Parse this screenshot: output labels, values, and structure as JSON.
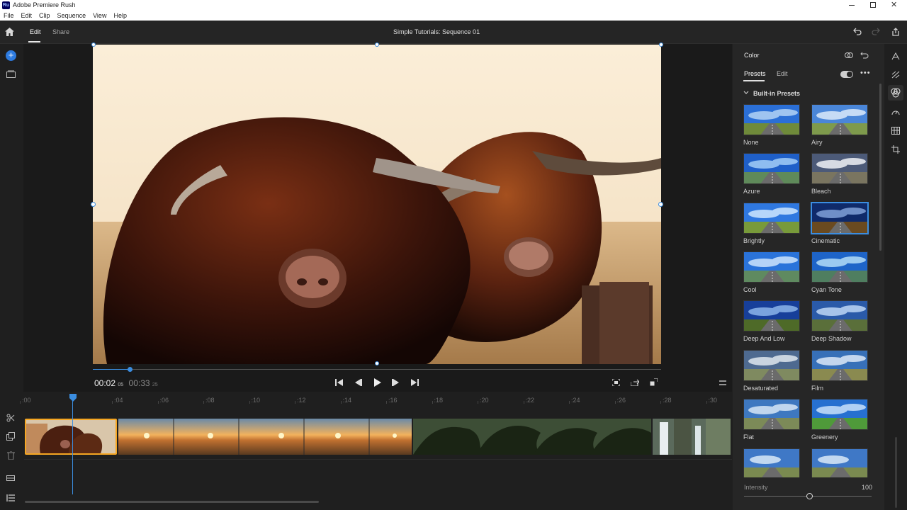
{
  "app": {
    "title": "Adobe Premiere Rush",
    "badge": "Ru"
  },
  "menu": [
    "File",
    "Edit",
    "Clip",
    "Sequence",
    "View",
    "Help"
  ],
  "header": {
    "tabs": [
      "Edit",
      "Share"
    ],
    "active_tab": "Edit",
    "sequence_title": "Simple Tutorials: Sequence 01"
  },
  "playback": {
    "current_time": "00:02",
    "current_frames": "05",
    "total_time": "00:33",
    "total_frames": "25",
    "scrub_fraction": 0.065
  },
  "timeline": {
    "ticks": [
      ":00",
      ":04",
      ":06",
      ":08",
      ":10",
      ":12",
      ":14",
      ":16",
      ":18",
      ":20",
      ":22",
      ":24",
      ":26",
      ":28",
      ":30"
    ]
  },
  "color_panel": {
    "title": "Color",
    "tabs": [
      "Presets",
      "Edit"
    ],
    "active_tab": "Presets",
    "section": "Built-in Presets",
    "presets": [
      "None",
      "Airy",
      "Azure",
      "Bleach",
      "Brightly",
      "Cinematic",
      "Cool",
      "Cyan Tone",
      "Deep And Low",
      "Deep Shadow",
      "Desaturated",
      "Film",
      "Flat",
      "Greenery"
    ],
    "selected_preset": "Cinematic",
    "intensity_label": "Intensity",
    "intensity_value": "100"
  },
  "colors": {
    "accent": "#3b8de0",
    "clip_selected": "#f5a623"
  },
  "icons": [
    "home-icon",
    "undo-icon",
    "redo-icon",
    "share-icon",
    "add-media-icon",
    "media-icon",
    "scissors-icon",
    "duplicate-icon",
    "trash-icon",
    "play-icon",
    "skip-back-icon",
    "step-back-icon",
    "step-forward-icon",
    "skip-forward-icon",
    "fit-icon",
    "export-frame-icon",
    "fullscreen-icon",
    "menu-icon",
    "chevron-down-icon",
    "more-icon",
    "color-icon",
    "speed-icon",
    "crop-icon"
  ]
}
